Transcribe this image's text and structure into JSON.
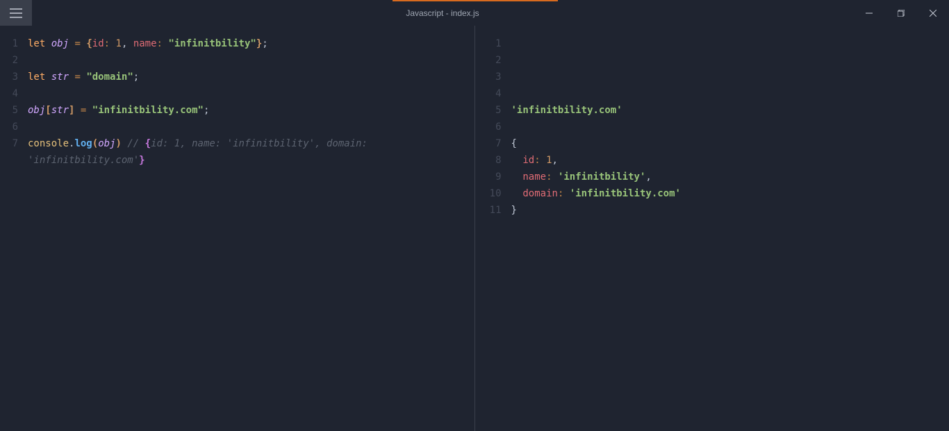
{
  "window": {
    "title": "Javascript - index.js"
  },
  "tab_indicator": true,
  "left": {
    "gutter": [
      "1",
      "2",
      "3",
      "4",
      "5",
      "6",
      "7",
      ""
    ],
    "lines": [
      [
        {
          "t": "let ",
          "c": "kw"
        },
        {
          "t": "obj",
          "c": "var"
        },
        {
          "t": " ",
          "c": "white"
        },
        {
          "t": "=",
          "c": "op"
        },
        {
          "t": " ",
          "c": "white"
        },
        {
          "t": "{",
          "c": "paren-h1 bold"
        },
        {
          "t": "id",
          "c": "prop"
        },
        {
          "t": ":",
          "c": "op"
        },
        {
          "t": " ",
          "c": "white"
        },
        {
          "t": "1",
          "c": "num"
        },
        {
          "t": ",",
          "c": "punc"
        },
        {
          "t": " ",
          "c": "white"
        },
        {
          "t": "name",
          "c": "prop"
        },
        {
          "t": ":",
          "c": "op"
        },
        {
          "t": " ",
          "c": "white"
        },
        {
          "t": "\"infinitbility\"",
          "c": "str"
        },
        {
          "t": "}",
          "c": "paren-h1 bold"
        },
        {
          "t": ";",
          "c": "punc"
        }
      ],
      [],
      [
        {
          "t": "let ",
          "c": "kw"
        },
        {
          "t": "str",
          "c": "var"
        },
        {
          "t": " ",
          "c": "white"
        },
        {
          "t": "=",
          "c": "op"
        },
        {
          "t": " ",
          "c": "white"
        },
        {
          "t": "\"domain\"",
          "c": "str"
        },
        {
          "t": ";",
          "c": "punc"
        }
      ],
      [],
      [
        {
          "t": "obj",
          "c": "var"
        },
        {
          "t": "[",
          "c": "paren-h1 bold"
        },
        {
          "t": "str",
          "c": "var"
        },
        {
          "t": "]",
          "c": "paren-h1 bold"
        },
        {
          "t": " ",
          "c": "white"
        },
        {
          "t": "=",
          "c": "op"
        },
        {
          "t": " ",
          "c": "white"
        },
        {
          "t": "\"infinitbility.com\"",
          "c": "str"
        },
        {
          "t": ";",
          "c": "punc"
        }
      ],
      [],
      [
        {
          "t": "console",
          "c": "obj"
        },
        {
          "t": ".",
          "c": "punc"
        },
        {
          "t": "log",
          "c": "fn bold"
        },
        {
          "t": "(",
          "c": "paren-h1 bold"
        },
        {
          "t": "obj",
          "c": "var"
        },
        {
          "t": ")",
          "c": "paren-h1 bold"
        },
        {
          "t": " ",
          "c": "white"
        },
        {
          "t": "// ",
          "c": "cmt"
        },
        {
          "t": "{",
          "c": "paren-h2 bold"
        },
        {
          "t": "id: 1, name: 'infinitbility', domain: ",
          "c": "cmt"
        }
      ],
      [
        {
          "t": "'infinitbility.com'",
          "c": "cmt"
        },
        {
          "t": "}",
          "c": "paren-h2 bold"
        }
      ]
    ]
  },
  "right": {
    "gutter": [
      "1",
      "2",
      "3",
      "4",
      "5",
      "6",
      "7",
      "8",
      "9",
      "10",
      "11"
    ],
    "lines": [
      [],
      [],
      [],
      [],
      [
        {
          "t": "'infinitbility.com'",
          "c": "str"
        }
      ],
      [],
      [
        {
          "t": "{",
          "c": "punc"
        }
      ],
      [
        {
          "t": "  ",
          "c": "white"
        },
        {
          "t": "id",
          "c": "prop"
        },
        {
          "t": ":",
          "c": "op"
        },
        {
          "t": " ",
          "c": "white"
        },
        {
          "t": "1",
          "c": "num"
        },
        {
          "t": ",",
          "c": "punc"
        }
      ],
      [
        {
          "t": "  ",
          "c": "white"
        },
        {
          "t": "name",
          "c": "prop"
        },
        {
          "t": ":",
          "c": "op"
        },
        {
          "t": " ",
          "c": "white"
        },
        {
          "t": "'infinitbility'",
          "c": "str"
        },
        {
          "t": ",",
          "c": "punc"
        }
      ],
      [
        {
          "t": "  ",
          "c": "white"
        },
        {
          "t": "domain",
          "c": "prop"
        },
        {
          "t": ":",
          "c": "op"
        },
        {
          "t": " ",
          "c": "white"
        },
        {
          "t": "'infinitbility.com'",
          "c": "str"
        }
      ],
      [
        {
          "t": "}",
          "c": "punc"
        }
      ]
    ]
  }
}
